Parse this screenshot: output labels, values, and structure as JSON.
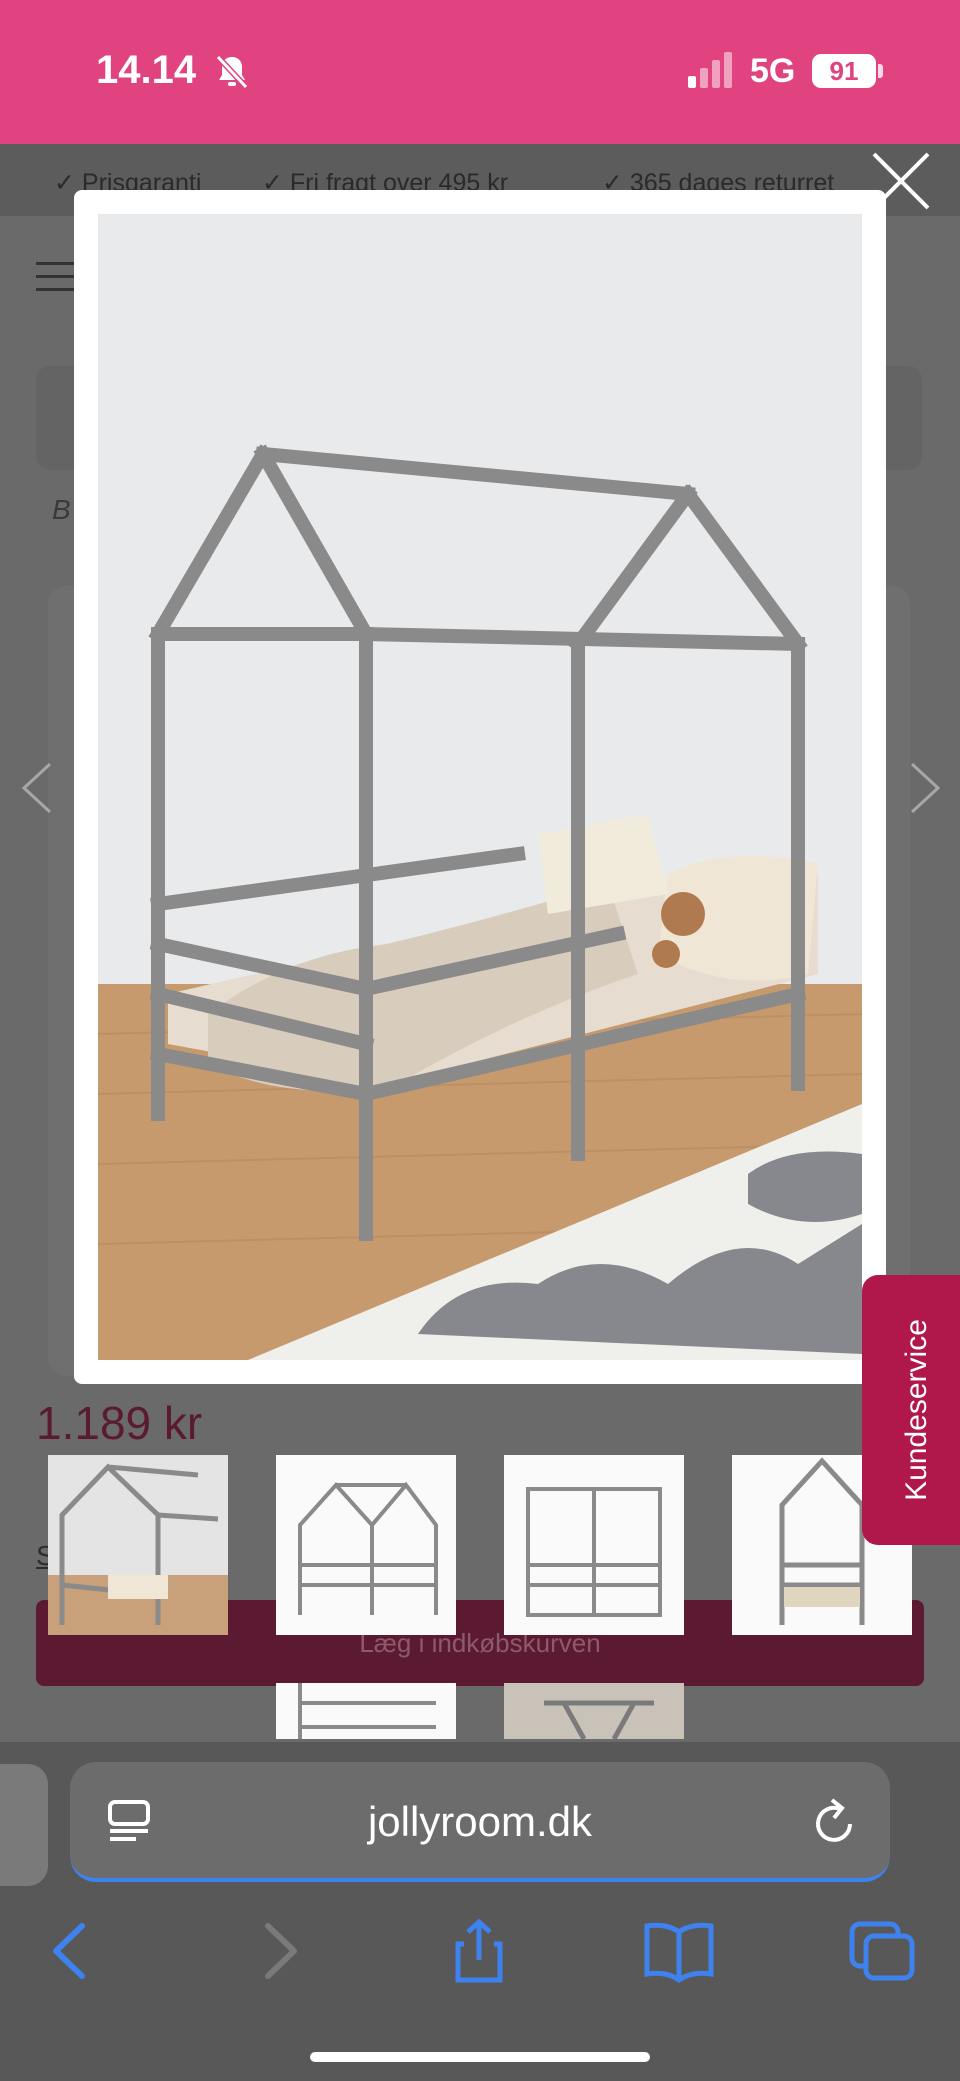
{
  "status_bar": {
    "time": "14.14",
    "network": "5G",
    "battery": "91"
  },
  "usp_bar": {
    "items": [
      "✓ Prisgaranti",
      "✓ Fri fragt over 495 kr",
      "✓ 365 dages returret"
    ]
  },
  "page": {
    "breadcrumb": "B /",
    "price": "1.189 kr",
    "save_link": "S                    k",
    "cart_button": "Læg i indkøbskurven"
  },
  "side_tab": {
    "label": "Kundeservice"
  },
  "browser": {
    "url": "jollyroom.dk"
  },
  "colors": {
    "status_pink": "#e0437f",
    "brand_red": "#b0184c",
    "link_blue": "#3e82f0"
  }
}
